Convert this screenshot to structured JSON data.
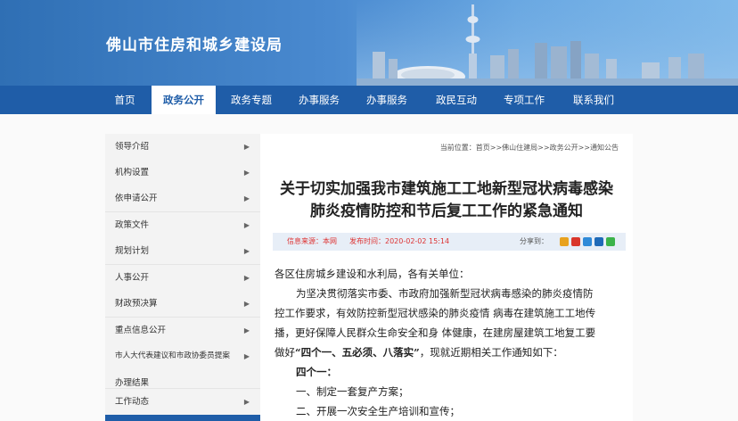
{
  "banner": {
    "title": "佛山市住房和城乡建设局",
    "skyline": "city-skyline-photo"
  },
  "nav": {
    "items": [
      "首页",
      "政务公开",
      "政务专题",
      "办事服务",
      "政民互动",
      "专项工作",
      "联系我们"
    ],
    "active": "政务公开"
  },
  "sidebar": {
    "items": [
      {
        "label": "领导介绍",
        "arrow": "▶"
      },
      {
        "label": "机构设置",
        "arrow": "▶"
      },
      {
        "label": "依申请公开",
        "arrow": "▶"
      },
      {
        "label": "政策文件",
        "arrow": "▶"
      },
      {
        "label": "规划计划",
        "arrow": "▶"
      },
      {
        "label": "人事公开",
        "arrow": "▶"
      },
      {
        "label": "财政预决算",
        "arrow": "▶"
      },
      {
        "label": "重点信息公开",
        "arrow": "▶"
      },
      {
        "label": "市人大代表建议和市政协委员提案",
        "arrow": "▶"
      },
      {
        "label": "办理结果",
        "arrow": ""
      },
      {
        "label": "工作动态",
        "arrow": "▶"
      }
    ]
  },
  "content": {
    "breadcrumb": "当前位置：首页>>佛山住建局>>政务公开>>通知公告",
    "title_line1": "关于切实加强我市建筑施工工地新型冠状病毒感染",
    "title_line2": "肺炎疫情防控和节后复工工作的紧急通知",
    "meta_source": "信息来源：本网",
    "meta_date": "发布时间：2020-02-02 15:14",
    "share_label": "分享到：",
    "share_icons": [
      {
        "name": "qzone-share-icon",
        "color": "#e8a21f"
      },
      {
        "name": "weibo-share-icon",
        "color": "#d9362b"
      },
      {
        "name": "tencent-weibo-share-icon",
        "color": "#2f8ad8"
      },
      {
        "name": "renren-share-icon",
        "color": "#1f6ab8"
      },
      {
        "name": "wechat-share-icon",
        "color": "#3bb34a"
      }
    ],
    "body": {
      "salutation": "各区住房城乡建设和水利局，各有关单位：",
      "p1_l1": "为坚决贯彻落实市委、市政府加强新型冠状病毒感染的肺炎疫情防",
      "p1_l2": "控工作要求，有效防控新型冠状感染的肺炎疫情 病毒在建筑施工工地传",
      "p1_l3": "播，更好保障人民群众生命安全和身 体健康，在建房屋建筑工地复工要",
      "p1_l4_pre": "做好",
      "p1_l4_bold": "“四个一、五必须、八落实”",
      "p1_l4_post": "，现就近期相关工作通知如下：",
      "heading": "四个一：",
      "item1": "一、制定一套复产方案；",
      "item2": "二、开展一次安全生产培训和宣传；"
    }
  }
}
